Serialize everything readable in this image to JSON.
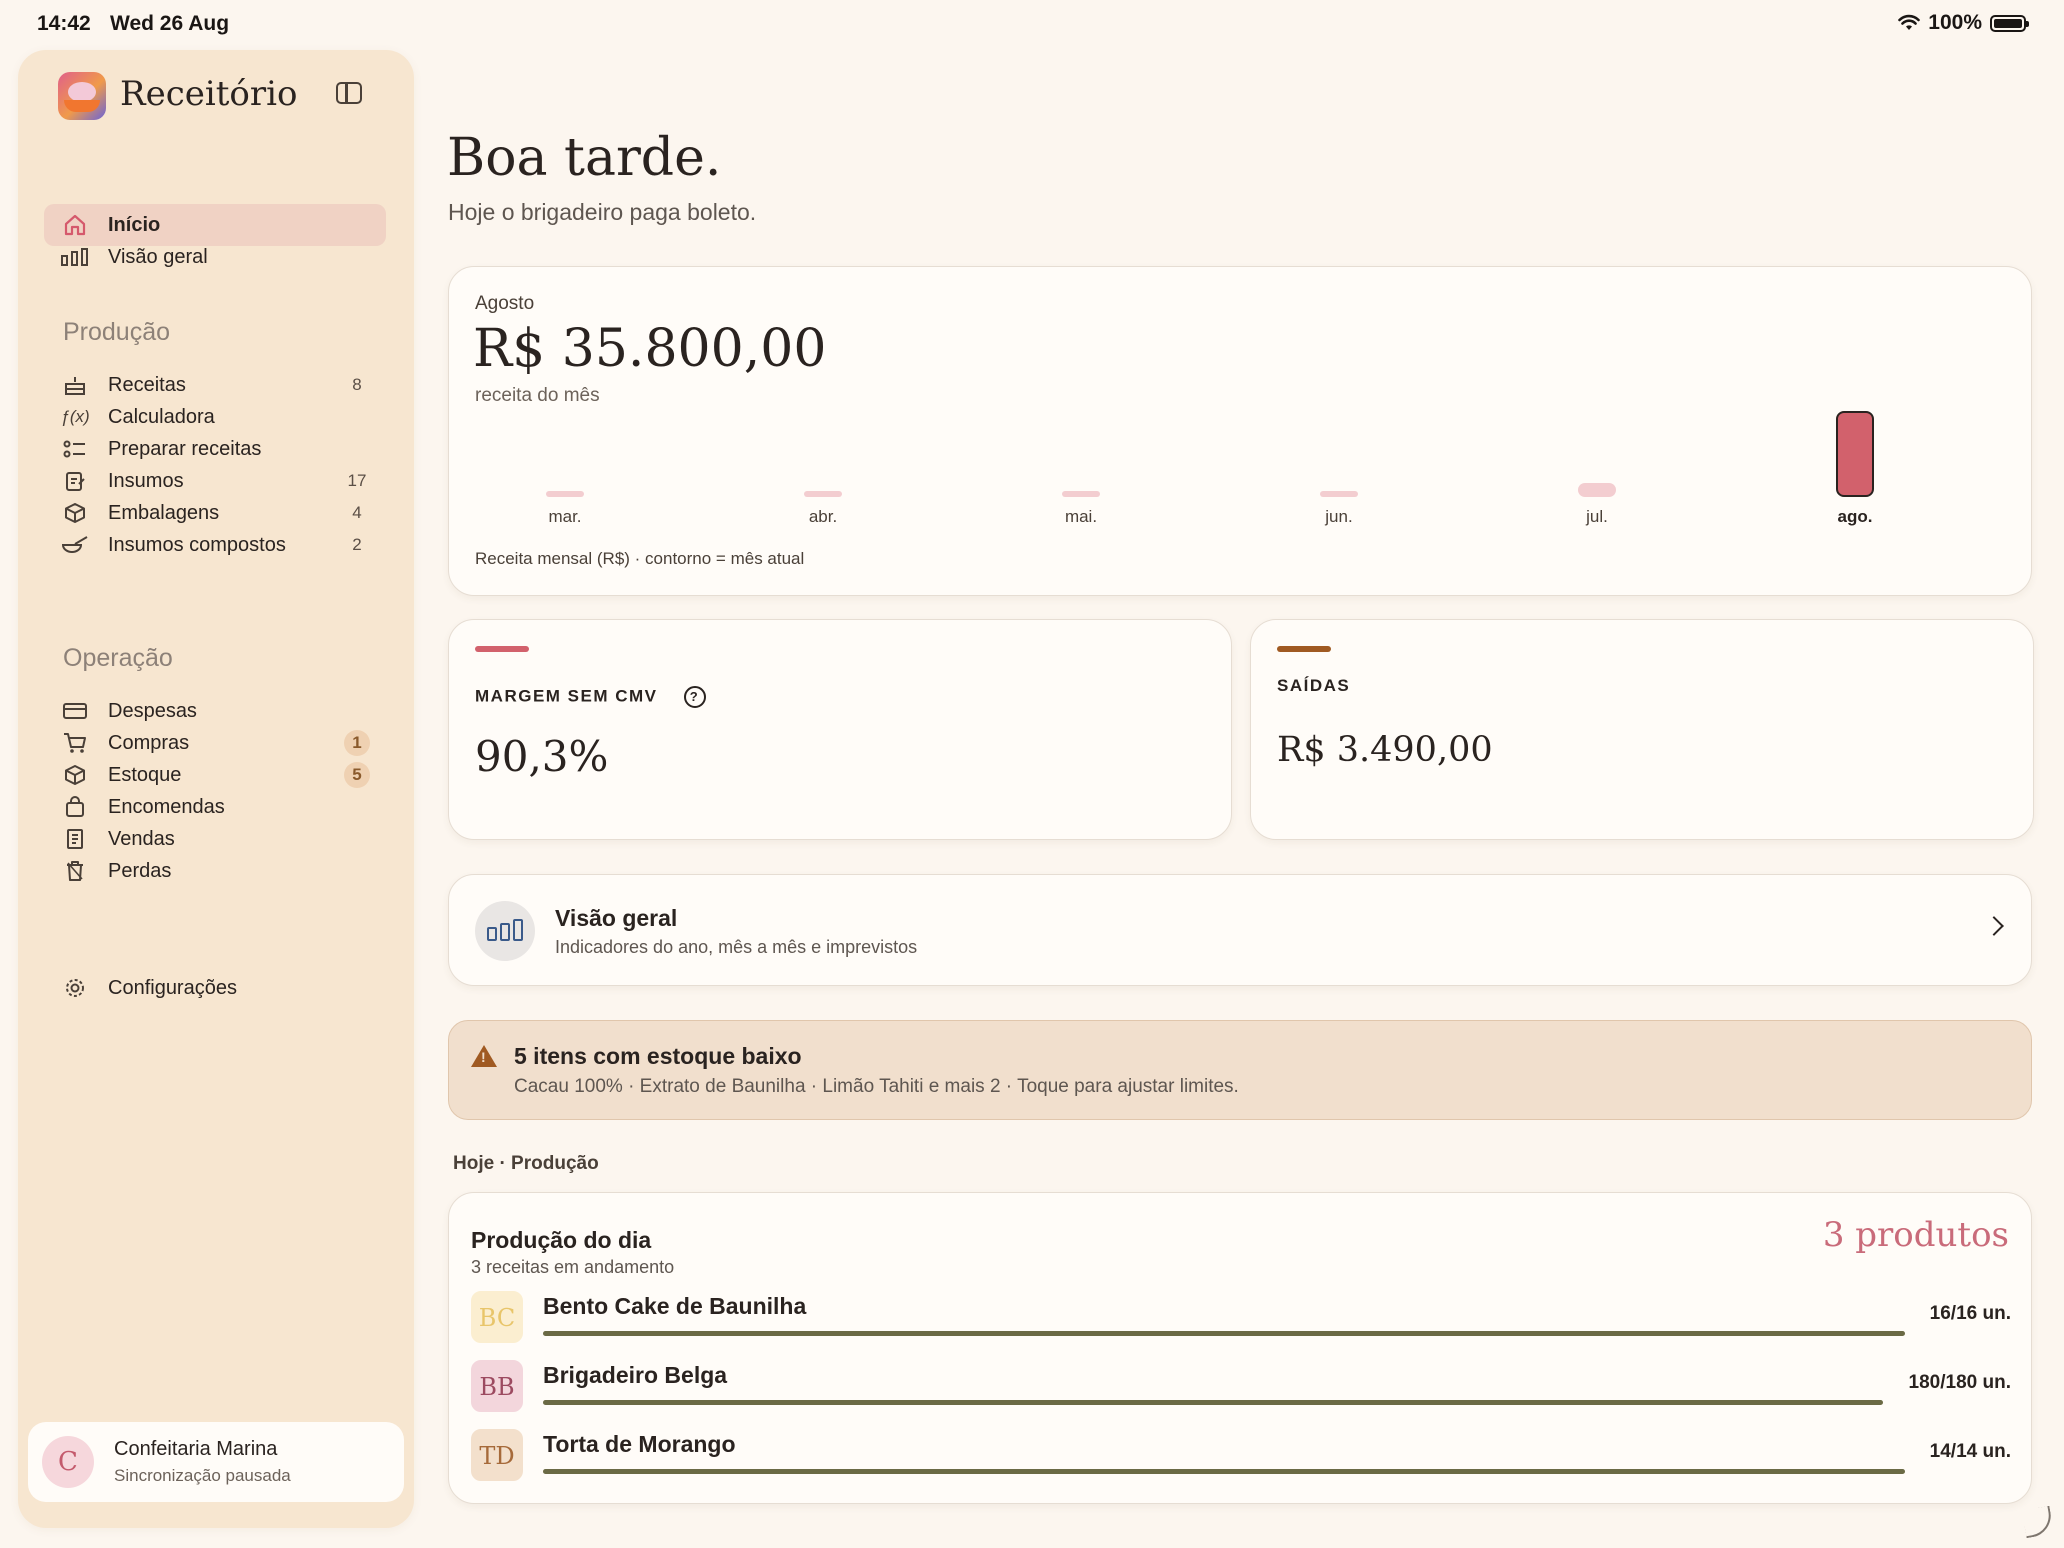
{
  "status_bar": {
    "time": "14:42",
    "date": "Wed 26 Aug",
    "battery": "100%"
  },
  "sidebar": {
    "app_title": "Receitório",
    "top_items": [
      {
        "label": "Início",
        "icon": "home-icon",
        "active": true
      },
      {
        "label": "Visão geral",
        "icon": "bar-chart-icon"
      }
    ],
    "sections": [
      {
        "title": "Produção",
        "items": [
          {
            "label": "Receitas",
            "icon": "cake-icon",
            "count": "8"
          },
          {
            "label": "Calculadora",
            "icon": "function-icon",
            "count": ""
          },
          {
            "label": "Preparar receitas",
            "icon": "checklist-icon",
            "count": ""
          },
          {
            "label": "Insumos",
            "icon": "clipboard-edit-icon",
            "count": "17"
          },
          {
            "label": "Embalagens",
            "icon": "box-icon",
            "count": "4"
          },
          {
            "label": "Insumos compostos",
            "icon": "bowl-whisk-icon",
            "count": "2"
          }
        ]
      },
      {
        "title": "Operação",
        "items": [
          {
            "label": "Despesas",
            "icon": "credit-card-icon",
            "count": ""
          },
          {
            "label": "Compras",
            "icon": "cart-icon",
            "count": "1",
            "pill": true
          },
          {
            "label": "Estoque",
            "icon": "package-icon",
            "count": "5",
            "pill": true
          },
          {
            "label": "Encomendas",
            "icon": "bag-icon",
            "count": ""
          },
          {
            "label": "Vendas",
            "icon": "receipt-icon",
            "count": ""
          },
          {
            "label": "Perdas",
            "icon": "trash-icon",
            "count": ""
          }
        ]
      }
    ],
    "settings_label": "Configurações",
    "account": {
      "initial": "C",
      "name": "Confeitaria Marina",
      "status": "Sincronização pausada"
    }
  },
  "main": {
    "greeting": "Boa tarde.",
    "greeting_sub": "Hoje o brigadeiro paga boleto.",
    "revenue": {
      "month": "Agosto",
      "value": "R$ 35.800,00",
      "subtitle": "receita do mês",
      "caption": "Receita mensal (R$) · contorno = mês atual"
    },
    "margin": {
      "label": "MARGEM SEM CMV",
      "value": "90,3%",
      "accent": "#d2616c"
    },
    "outflows": {
      "label": "SAÍDAS",
      "value": "R$ 3.490,00",
      "accent": "#a05a22"
    },
    "overview": {
      "title": "Visão geral",
      "subtitle": "Indicadores do ano, mês a mês e imprevistos"
    },
    "alert": {
      "title": "5 itens com estoque baixo",
      "subtitle": "Cacau 100% · Extrato de Baunilha · Limão Tahiti e mais 2 · Toque para ajustar limites."
    },
    "today_label": "Hoje · Produção",
    "production": {
      "title": "Produção do dia",
      "subtitle": "3 receitas em andamento",
      "count": "3 produtos",
      "items": [
        {
          "initials": "BC",
          "name": "Bento Cake de Baunilha",
          "qty": "16/16 un.",
          "progress": 1.0,
          "badge_bg": "#fbeed0",
          "badge_fg": "#e8c56a"
        },
        {
          "initials": "BB",
          "name": "Brigadeiro Belga",
          "qty": "180/180 un.",
          "progress": 1.0,
          "badge_bg": "#f3d6dc",
          "badge_fg": "#9c4a60"
        },
        {
          "initials": "TD",
          "name": "Torta de Morango",
          "qty": "14/14 un.",
          "progress": 1.0,
          "badge_bg": "#f3e0cc",
          "badge_fg": "#a66a3a"
        }
      ]
    }
  },
  "chart_data": {
    "type": "bar",
    "categories": [
      "mar.",
      "abr.",
      "mai.",
      "jun.",
      "jul.",
      "ago."
    ],
    "values": [
      0,
      0,
      0,
      0,
      6000,
      35800
    ],
    "current_index": 5,
    "title": "",
    "xlabel": "",
    "ylabel": "Receita mensal (R$)",
    "ylim": [
      0,
      35800
    ],
    "grid": false,
    "colors": {
      "past": "#f3cdd0",
      "current": "#d2616c"
    }
  }
}
